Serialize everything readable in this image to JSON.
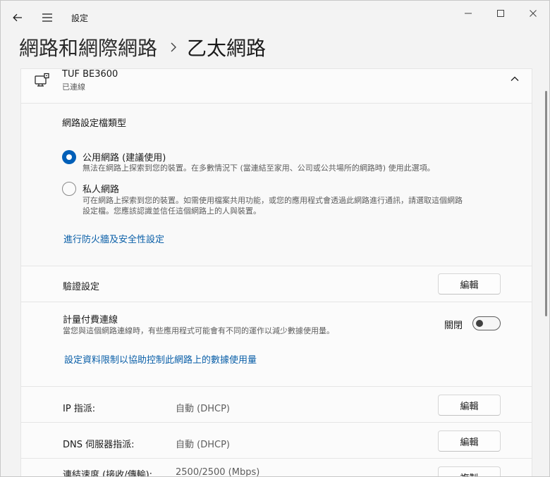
{
  "app": {
    "title": "設定"
  },
  "breadcrumb": {
    "parent": "網路和網際網路",
    "current": "乙太網路"
  },
  "device": {
    "name": "TUF BE3600",
    "status": "已連線"
  },
  "profile": {
    "title": "網路設定檔類型",
    "options": [
      {
        "label": "公用網路 (建議使用)",
        "desc": "無法在網路上探索到您的裝置。在多數情況下 (當連結至家用、公司或公共場所的網路時) 使用此選項。",
        "checked": true
      },
      {
        "label": "私人網路",
        "desc_line1": "可在網路上探索到您的裝置。如需使用檔案共用功能，或您的應用程式會透過此網路進行通訊，請選取這個網路",
        "desc_line2": "設定檔。您應該認識並信任這個網路上的人與裝置。",
        "checked": false
      }
    ],
    "firewall_link": "進行防火牆及安全性設定"
  },
  "auth": {
    "label": "驗證設定",
    "button": "編輯"
  },
  "metered": {
    "label": "計量付費連線",
    "desc": "當您與這個網路連線時，有些應用程式可能會有不同的運作以減少數據使用量。",
    "state_text": "關閉",
    "on": false,
    "data_limit_link": "設定資料限制以協助控制此網路上的數據使用量"
  },
  "ip": {
    "label": "IP 指派:",
    "value": "自動 (DHCP)",
    "button": "編輯"
  },
  "dns": {
    "label": "DNS 伺服器指派:",
    "value": "自動 (DHCP)",
    "button": "編輯"
  },
  "speed": {
    "label": "連結速度 (接收/傳輸):",
    "value": "2500/2500 (Mbps)",
    "button": "複製"
  },
  "colors": {
    "accent": "#005fb8",
    "link": "#0a5fa8"
  }
}
